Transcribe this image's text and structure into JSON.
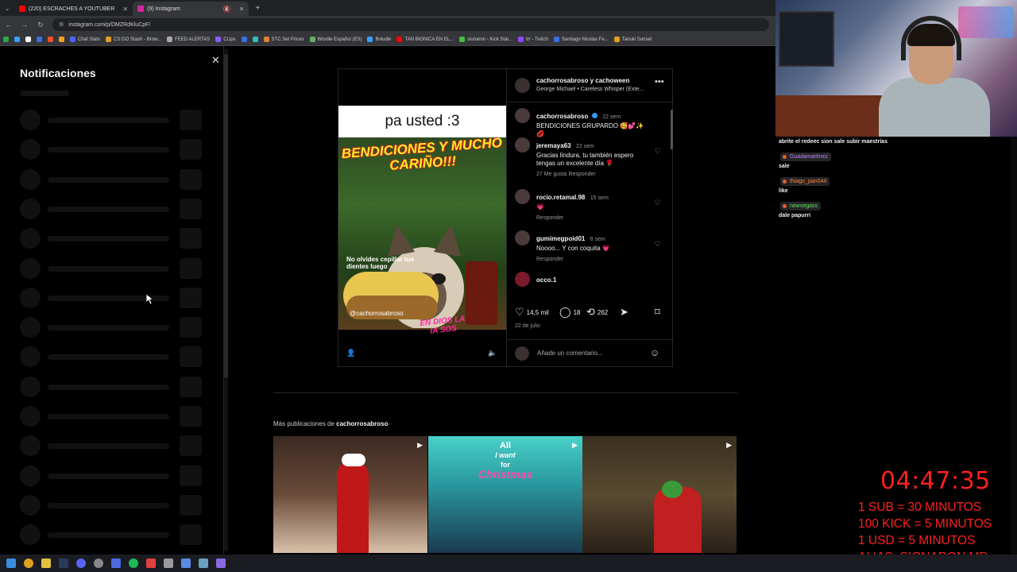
{
  "browser": {
    "tabs": [
      {
        "label": "(220) ESCRACHES A YOUTUBER",
        "color": "#ff0000"
      },
      {
        "label": "(9) Instagram",
        "color": "#d6249f"
      }
    ],
    "url": "instagram.com/p/DMZRdKluCpF/",
    "bookmarks": [
      {
        "label": "",
        "color": "#2aa84a"
      },
      {
        "label": "",
        "color": "#3aa0ff"
      },
      {
        "label": "",
        "color": "#ffffff"
      },
      {
        "label": "",
        "color": "#3a70e0"
      },
      {
        "label": "",
        "color": "#ff5030"
      },
      {
        "label": "",
        "color": "#f0a020"
      },
      {
        "label": "Chat Stats",
        "color": "#5060ff"
      },
      {
        "label": "CS:GO Stash - Brow...",
        "color": "#e0a020"
      },
      {
        "label": "FEED ALERTAS",
        "color": "#aaaaaa"
      },
      {
        "label": "CLips",
        "color": "#8a5cff"
      },
      {
        "label": "",
        "color": "#3a70e0"
      },
      {
        "label": "",
        "color": "#30c0c0"
      },
      {
        "label": "STC Set Prices",
        "color": "#e08030"
      },
      {
        "label": "Wordle Español (ES)",
        "color": "#6aaa64"
      },
      {
        "label": "Boludle",
        "color": "#3aa0ff"
      },
      {
        "label": "TAN BIONICA EN EL...",
        "color": "#ff0000"
      },
      {
        "label": "sionaron - Kick Stat...",
        "color": "#40c040"
      },
      {
        "label": "trr - Twitch",
        "color": "#9146ff"
      },
      {
        "label": "Santiago Nicolas Fe...",
        "color": "#3a70e0"
      },
      {
        "label": "Tanuki Sunset",
        "color": "#e0a020"
      }
    ]
  },
  "notifications": {
    "title": "Notificaciones",
    "close_icon": "close-icon"
  },
  "post": {
    "media": {
      "top_text": "pa usted :3",
      "headline": "BENDICIONES Y MUCHO CARIÑO!!!",
      "small_caption": "No olvides cepillar tus dientes luego",
      "watermark": "@cachorrosabroso",
      "badge": "EN DIOS LA IA SOS"
    },
    "header": {
      "author": "cachorrosabroso y cachoween",
      "music": "George Michael • Careless Whisper (Exte..."
    },
    "comments": [
      {
        "name": "cachorrosabroso",
        "time": "22 sem",
        "text": "BENDICIONES GRUPARDO 🥰💕✨💋",
        "meta": "",
        "verified": true
      },
      {
        "name": "jeremaya63",
        "time": "22 sem",
        "text": "Gracias lindura, tu también espero tengas un excelente día 🌹",
        "meta": "27 Me gusta   Responder",
        "verified": false
      },
      {
        "name": "rocio.retamal.98",
        "time": "15 sem",
        "text": "💗",
        "meta": "Responder",
        "verified": false
      },
      {
        "name": "gumimegpoid01",
        "time": "6 sem",
        "text": "Noooo... Y con coquita 💗",
        "meta": "Responder",
        "verified": false
      },
      {
        "name": "occo.1",
        "time": "",
        "text": "",
        "meta": "",
        "verified": false
      }
    ],
    "actions": {
      "likes": "14,5 mil",
      "comments": "18",
      "reposts": "262"
    },
    "date": "22 de julio",
    "comment_placeholder": "Añade un comentario..."
  },
  "more": {
    "prefix": "Más publicaciones de ",
    "account": "cachorrosabroso",
    "thumb2_text_a": "All",
    "thumb2_text_b": "I want",
    "thumb2_text_c": "for",
    "thumb2_text_d": "Christmas"
  },
  "stream": {
    "chat": [
      {
        "kind": "line",
        "text": "abrite el redeec sion sale subir maestrías"
      },
      {
        "kind": "user",
        "text": "Guadamartinez",
        "color": "#c080ff"
      },
      {
        "kind": "line",
        "text": "sale"
      },
      {
        "kind": "user",
        "text": "thiago_pan044",
        "color": "#ff8040"
      },
      {
        "kind": "line",
        "text": "like"
      },
      {
        "kind": "user",
        "text": "newvegass",
        "color": "#60e060"
      },
      {
        "kind": "line",
        "text": "dale papurri"
      }
    ],
    "timer": "04:47:35",
    "rules": [
      "1 SUB = 30 MINUTOS",
      "100 KICK = 5 MINUTOS",
      "1 USD = 5 MINUTOS",
      "ALIAS: SIONARON.MP"
    ]
  },
  "colors": {
    "accent_red": "#ff2020",
    "ig_blue": "#3897f0",
    "bg": "#000000"
  }
}
